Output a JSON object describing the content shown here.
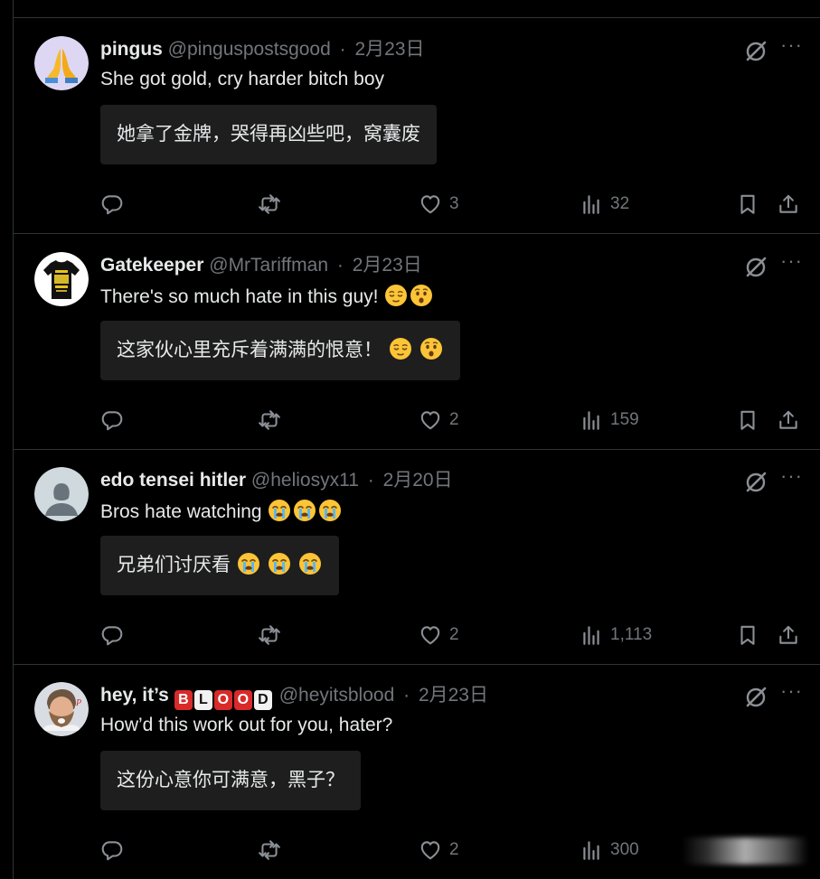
{
  "colors": {
    "background": "#000000",
    "text": "#e7e9ea",
    "muted": "#71767b",
    "divider": "#2f3336",
    "translation_bg": "#1e1e1e"
  },
  "tweets": [
    {
      "name": "pingus",
      "handle": "@pinguspostsgood",
      "separator": "·",
      "date": "2月23日",
      "text": "She got gold, cry harder bitch boy",
      "translation": "她拿了金牌，哭得再凶些吧，窝囊废",
      "replies": "",
      "reposts": "",
      "likes": "3",
      "views": "32",
      "avatar": "praying-hands"
    },
    {
      "name": "Gatekeeper",
      "handle": "@MrTariffman",
      "separator": "·",
      "date": "2月23日",
      "text": "There's so much hate in this guy!",
      "translation": "这家伙心里充斥着满满的恨意！",
      "replies": "",
      "reposts": "",
      "likes": "2",
      "views": "159",
      "avatar": "t-shirt",
      "emojis": [
        "relieved-face",
        "hushed-face"
      ]
    },
    {
      "name": "edo tensei hitler",
      "handle": "@heliosyx11",
      "separator": "·",
      "date": "2月20日",
      "text": "Bros hate watching",
      "translation": "兄弟们讨厌看",
      "replies": "",
      "reposts": "",
      "likes": "2",
      "views": "1,113",
      "avatar": "default-profile",
      "emojis": [
        "crying-face",
        "crying-face",
        "crying-face"
      ]
    },
    {
      "name": "hey, it’s",
      "name_badge": [
        "B",
        "L",
        "O",
        "O",
        "D"
      ],
      "handle": "@heyitsblood",
      "separator": "·",
      "date": "2月23日",
      "text": "How’d this work out for you, hater?",
      "translation": "这份心意你可满意，黑子？",
      "replies": "",
      "reposts": "",
      "likes": "2",
      "views": "300",
      "avatar": "bearded-player"
    }
  ]
}
